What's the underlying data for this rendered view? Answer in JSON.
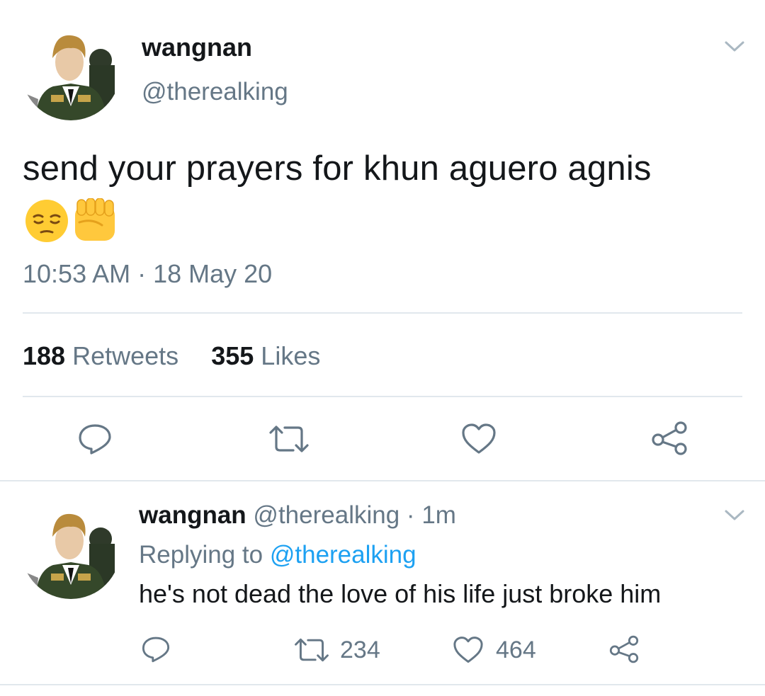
{
  "tweet": {
    "author_name": "wangnan",
    "author_handle": "@therealking",
    "text": "send your prayers for khun aguero agnis",
    "emojis": [
      "😔",
      "✊"
    ],
    "time": "10:53 AM · 18 May 20",
    "stats": {
      "retweets_count": "188",
      "retweets_label": "Retweets",
      "likes_count": "355",
      "likes_label": "Likes"
    },
    "actions": [
      "reply-icon",
      "retweet-icon",
      "heart-icon",
      "share-icon"
    ]
  },
  "reply": {
    "author_name": "wangnan",
    "author_handle": "@therealking",
    "separator": "·",
    "age": "1m",
    "replying_prefix": "Replying to",
    "replying_to": "@therealking",
    "text": "he's not dead the love of his life just broke him",
    "retweets": "234",
    "likes": "464"
  },
  "colors": {
    "text": "#14171a",
    "muted": "#657786",
    "link": "#1da1f2",
    "divider": "#e1e8ed",
    "icon": "#657786"
  }
}
